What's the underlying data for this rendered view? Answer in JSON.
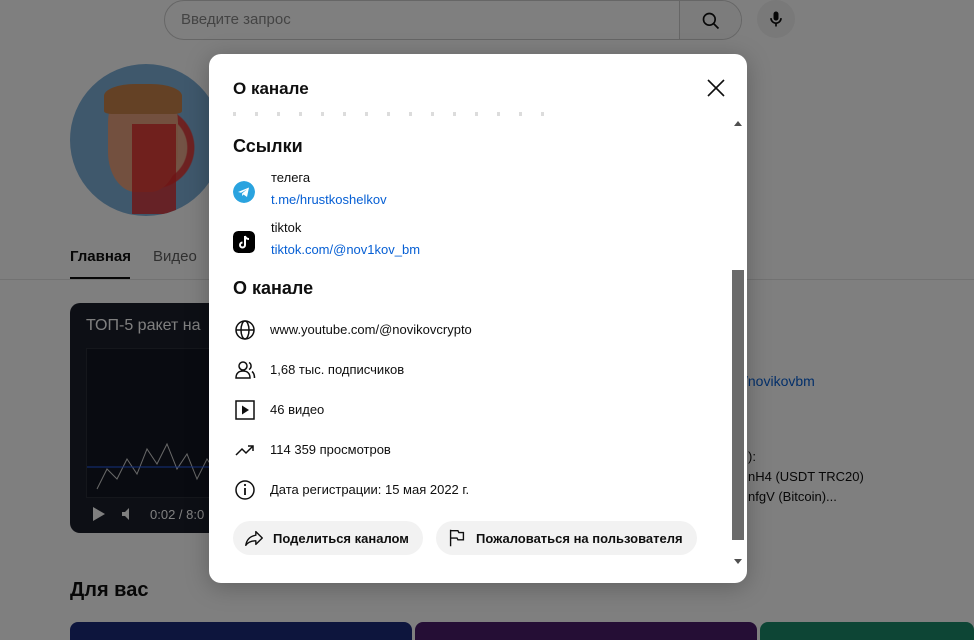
{
  "search": {
    "placeholder": "Введите запрос",
    "search_icon": "search-icon",
    "mic_icon": "mic-icon"
  },
  "channel": {
    "tabs": [
      {
        "label": "Главная",
        "active": true
      },
      {
        "label": "Видео",
        "active": false
      }
    ],
    "video": {
      "title": "ТОП-5 ракет на",
      "time": "0:02 / 8:0"
    },
    "side": {
      "link": "/novikovbm",
      "line1": "):",
      "line2": "nH4 (USDT TRC20)",
      "line3": "nfgV (Bitcoin)..."
    },
    "for_you": "Для вас"
  },
  "modal": {
    "title": "О канале",
    "links_heading": "Ссылки",
    "links": [
      {
        "name": "телега",
        "url": "t.me/hrustkoshelkov",
        "icon": "telegram-icon"
      },
      {
        "name": "tiktok",
        "url": "tiktok.com/@nov1kov_bm",
        "icon": "tiktok-icon"
      }
    ],
    "about_heading": "О канале",
    "info": {
      "url": "www.youtube.com/@novikovcrypto",
      "subscribers": "1,68 тыс. подписчиков",
      "videos": "46 видео",
      "views": "114 359 просмотров",
      "joined": "Дата регистрации: 15 мая 2022 г."
    },
    "actions": {
      "share": "Поделиться каналом",
      "report": "Пожаловаться на пользователя"
    }
  },
  "colors": {
    "link": "#065fd4",
    "telegram": "#2aa3df",
    "tiktok": "#000000",
    "pill_bg": "#f2f2f2"
  }
}
